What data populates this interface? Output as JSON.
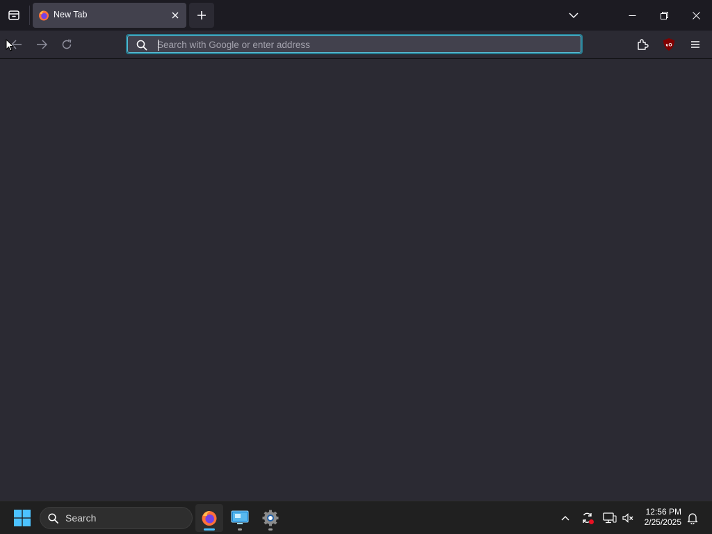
{
  "tabs": [
    {
      "title": "New Tab"
    }
  ],
  "urlbar": {
    "placeholder": "Search with Google or enter address",
    "value": ""
  },
  "taskbar": {
    "search_label": "Search",
    "time": "12:56 PM",
    "date": "2/25/2025"
  },
  "colors": {
    "accent": "#00ddff",
    "window_bg": "#2b2a33",
    "tabbar_bg": "#1c1b22",
    "taskbar_bg": "#202020",
    "ublock_red": "#800000"
  },
  "icons": {
    "firefox_view": "firefox-view-icon",
    "back": "back-arrow-icon",
    "forward": "forward-arrow-icon",
    "reload": "reload-icon",
    "search": "search-icon",
    "extensions": "extensions-icon",
    "ublock": "ublock-origin-icon",
    "menu": "hamburger-menu-icon"
  }
}
